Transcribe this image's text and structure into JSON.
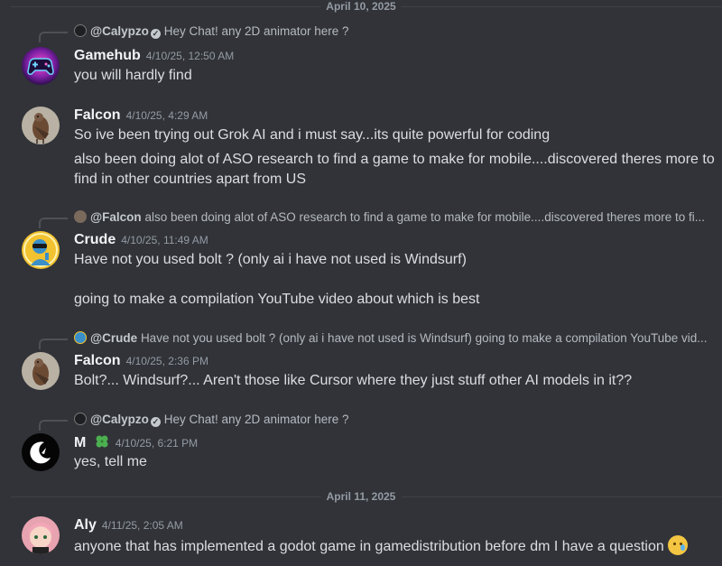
{
  "dividers": {
    "d1": "April 10, 2025",
    "d2": "April 11, 2025"
  },
  "messages": {
    "m1": {
      "reply": {
        "name": "@Calypzo",
        "text": "Hey Chat! any 2D animator here ?"
      },
      "author": "Gamehub",
      "timestamp": "4/10/25, 12:50 AM",
      "lines": [
        "you will hardly find"
      ]
    },
    "m2": {
      "author": "Falcon",
      "timestamp": "4/10/25, 4:29 AM",
      "lines": [
        "So ive been trying out Grok AI and i must say...its quite powerful for coding",
        "also been doing alot of ASO research to find a game to make for mobile....discovered theres more to",
        "find in other countries apart from US"
      ]
    },
    "m3": {
      "reply": {
        "name": "@Falcon",
        "text": "also been doing alot of ASO research to find a game to make for mobile....discovered theres more to fi..."
      },
      "author": "Crude",
      "timestamp": "4/10/25, 11:49 AM",
      "lines": [
        "Have not you used bolt ? (only ai i have not used is Windsurf)",
        "going to make a compilation YouTube video about which is best"
      ]
    },
    "m4": {
      "reply": {
        "name": "@Crude",
        "text": "Have not you used bolt ? (only ai i have not used is Windsurf)  going to make a compilation YouTube vid..."
      },
      "author": "Falcon",
      "timestamp": "4/10/25, 2:36 PM",
      "lines": [
        "Bolt?... Windsurf?... Aren't those like Cursor where they just stuff other AI models in it??"
      ]
    },
    "m5": {
      "reply": {
        "name": "@Calypzo",
        "text": "Hey Chat! any 2D animator here ?"
      },
      "author": "M",
      "timestamp": "4/10/25, 6:21 PM",
      "lines": [
        "yes, tell me"
      ]
    },
    "m6": {
      "author": "Aly",
      "timestamp": "4/11/25, 2:05 AM",
      "lines": [
        "anyone that has implemented a godot game in gamedistribution before dm I have a question"
      ]
    }
  },
  "icons": {
    "verified": "verified-badge-icon",
    "clover": "four-leaf-clover-icon",
    "emoji": "face-holding-back-tears-emoji"
  },
  "colors": {
    "background": "#313338",
    "author": "#f2f3f5",
    "text": "#dbdee1",
    "muted": "#949ba4"
  }
}
